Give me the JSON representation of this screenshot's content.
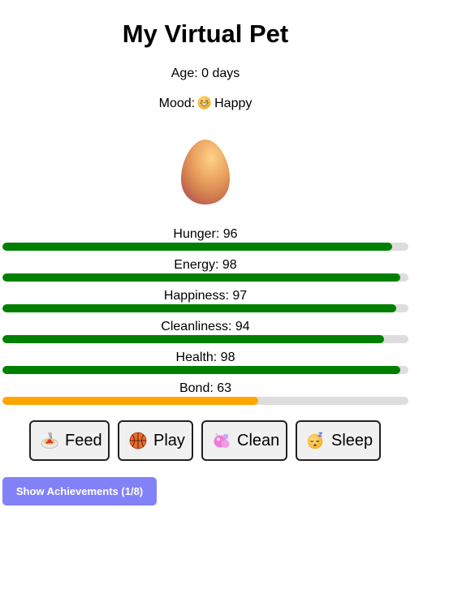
{
  "header": {
    "title": "My Virtual Pet"
  },
  "pet": {
    "age_text": "Age: 0 days",
    "mood_prefix": "Mood:",
    "mood_value": "Happy",
    "mood_icon": "grinning-face-icon",
    "avatar_icon": "egg-icon"
  },
  "stats": [
    {
      "label": "Hunger: 96",
      "value": 96,
      "color": "#008000"
    },
    {
      "label": "Energy: 98",
      "value": 98,
      "color": "#008000"
    },
    {
      "label": "Happiness: 97",
      "value": 97,
      "color": "#008000"
    },
    {
      "label": "Cleanliness: 94",
      "value": 94,
      "color": "#008000"
    },
    {
      "label": "Health: 98",
      "value": 98,
      "color": "#008000"
    },
    {
      "label": "Bond: 63",
      "value": 63,
      "color": "#ffa500"
    }
  ],
  "stat_track_color": "#dddddd",
  "actions": [
    {
      "label": "Feed",
      "icon": "spaghetti-icon"
    },
    {
      "label": "Play",
      "icon": "basketball-icon"
    },
    {
      "label": "Clean",
      "icon": "soap-bubbles-icon"
    },
    {
      "label": "Sleep",
      "icon": "sleeping-face-icon"
    }
  ],
  "achievements": {
    "button_label": "Show Achievements (1/8)",
    "color": "#8282f8"
  }
}
